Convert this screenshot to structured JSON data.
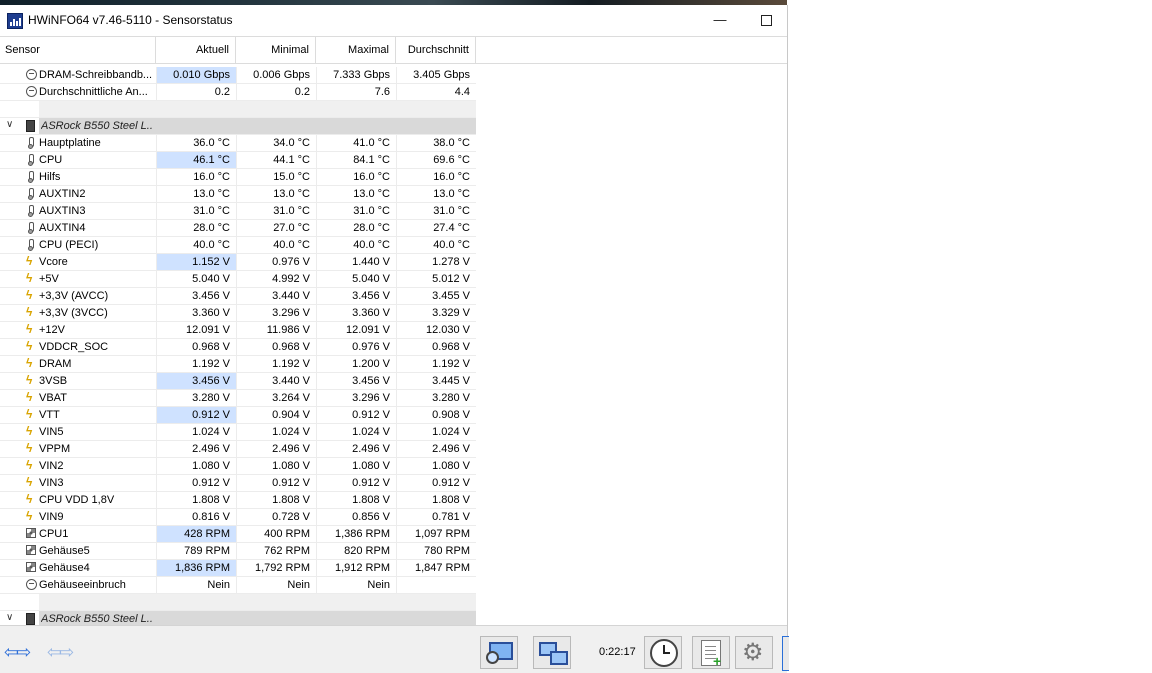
{
  "window": {
    "title": "HWiNFO64 v7.46-5110 - Sensorstatus",
    "min_glyph": "—"
  },
  "columns": {
    "sensor": "Sensor",
    "current": "Aktuell",
    "min": "Minimal",
    "max": "Maximal",
    "avg": "Durchschnitt"
  },
  "top_rows": [
    {
      "icon": "gauge-icon",
      "name": "DRAM-Schreibbandb...",
      "cur": "0.010 Gbps",
      "min": "0.006 Gbps",
      "max": "7.333 Gbps",
      "avg": "3.405 Gbps",
      "hl": true
    },
    {
      "icon": "gauge-icon",
      "name": "Durchschnittliche An...",
      "cur": "0.2",
      "min": "0.2",
      "max": "7.6",
      "avg": "4.4",
      "hl": false
    }
  ],
  "group1": {
    "name": "ASRock B550 Steel L...",
    "rows": [
      {
        "icon": "thermometer-icon",
        "name": "Hauptplatine",
        "cur": "36.0 °C",
        "min": "34.0 °C",
        "max": "41.0 °C",
        "avg": "38.0 °C",
        "hl": false
      },
      {
        "icon": "thermometer-icon",
        "name": "CPU",
        "cur": "46.1 °C",
        "min": "44.1 °C",
        "max": "84.1 °C",
        "avg": "69.6 °C",
        "hl": true
      },
      {
        "icon": "thermometer-icon",
        "name": "Hilfs",
        "cur": "16.0 °C",
        "min": "15.0 °C",
        "max": "16.0 °C",
        "avg": "16.0 °C",
        "hl": false
      },
      {
        "icon": "thermometer-icon",
        "name": "AUXTIN2",
        "cur": "13.0 °C",
        "min": "13.0 °C",
        "max": "13.0 °C",
        "avg": "13.0 °C",
        "hl": false
      },
      {
        "icon": "thermometer-icon",
        "name": "AUXTIN3",
        "cur": "31.0 °C",
        "min": "31.0 °C",
        "max": "31.0 °C",
        "avg": "31.0 °C",
        "hl": false
      },
      {
        "icon": "thermometer-icon",
        "name": "AUXTIN4",
        "cur": "28.0 °C",
        "min": "27.0 °C",
        "max": "28.0 °C",
        "avg": "27.4 °C",
        "hl": false
      },
      {
        "icon": "thermometer-icon",
        "name": "CPU (PECI)",
        "cur": "40.0 °C",
        "min": "40.0 °C",
        "max": "40.0 °C",
        "avg": "40.0 °C",
        "hl": false
      },
      {
        "icon": "voltage-icon",
        "name": "Vcore",
        "cur": "1.152 V",
        "min": "0.976 V",
        "max": "1.440 V",
        "avg": "1.278 V",
        "hl": true
      },
      {
        "icon": "voltage-icon",
        "name": "+5V",
        "cur": "5.040 V",
        "min": "4.992 V",
        "max": "5.040 V",
        "avg": "5.012 V",
        "hl": false
      },
      {
        "icon": "voltage-icon",
        "name": "+3,3V (AVCC)",
        "cur": "3.456 V",
        "min": "3.440 V",
        "max": "3.456 V",
        "avg": "3.455 V",
        "hl": false
      },
      {
        "icon": "voltage-icon",
        "name": "+3,3V (3VCC)",
        "cur": "3.360 V",
        "min": "3.296 V",
        "max": "3.360 V",
        "avg": "3.329 V",
        "hl": false
      },
      {
        "icon": "voltage-icon",
        "name": "+12V",
        "cur": "12.091 V",
        "min": "11.986 V",
        "max": "12.091 V",
        "avg": "12.030 V",
        "hl": false
      },
      {
        "icon": "voltage-icon",
        "name": "VDDCR_SOC",
        "cur": "0.968 V",
        "min": "0.968 V",
        "max": "0.976 V",
        "avg": "0.968 V",
        "hl": false
      },
      {
        "icon": "voltage-icon",
        "name": "DRAM",
        "cur": "1.192 V",
        "min": "1.192 V",
        "max": "1.200 V",
        "avg": "1.192 V",
        "hl": false
      },
      {
        "icon": "voltage-icon",
        "name": "3VSB",
        "cur": "3.456 V",
        "min": "3.440 V",
        "max": "3.456 V",
        "avg": "3.445 V",
        "hl": true
      },
      {
        "icon": "voltage-icon",
        "name": "VBAT",
        "cur": "3.280 V",
        "min": "3.264 V",
        "max": "3.296 V",
        "avg": "3.280 V",
        "hl": false
      },
      {
        "icon": "voltage-icon",
        "name": "VTT",
        "cur": "0.912 V",
        "min": "0.904 V",
        "max": "0.912 V",
        "avg": "0.908 V",
        "hl": true
      },
      {
        "icon": "voltage-icon",
        "name": "VIN5",
        "cur": "1.024 V",
        "min": "1.024 V",
        "max": "1.024 V",
        "avg": "1.024 V",
        "hl": false
      },
      {
        "icon": "voltage-icon",
        "name": "VPPM",
        "cur": "2.496 V",
        "min": "2.496 V",
        "max": "2.496 V",
        "avg": "2.496 V",
        "hl": false
      },
      {
        "icon": "voltage-icon",
        "name": "VIN2",
        "cur": "1.080 V",
        "min": "1.080 V",
        "max": "1.080 V",
        "avg": "1.080 V",
        "hl": false
      },
      {
        "icon": "voltage-icon",
        "name": "VIN3",
        "cur": "0.912 V",
        "min": "0.912 V",
        "max": "0.912 V",
        "avg": "0.912 V",
        "hl": false
      },
      {
        "icon": "voltage-icon",
        "name": "CPU VDD 1,8V",
        "cur": "1.808 V",
        "min": "1.808 V",
        "max": "1.808 V",
        "avg": "1.808 V",
        "hl": false
      },
      {
        "icon": "voltage-icon",
        "name": "VIN9",
        "cur": "0.816 V",
        "min": "0.728 V",
        "max": "0.856 V",
        "avg": "0.781 V",
        "hl": false
      },
      {
        "icon": "fan-icon",
        "name": "CPU1",
        "cur": "428 RPM",
        "min": "400 RPM",
        "max": "1,386 RPM",
        "avg": "1,097 RPM",
        "hl": true
      },
      {
        "icon": "fan-icon",
        "name": "Gehäuse5",
        "cur": "789 RPM",
        "min": "762 RPM",
        "max": "820 RPM",
        "avg": "780 RPM",
        "hl": false
      },
      {
        "icon": "fan-icon",
        "name": "Gehäuse4",
        "cur": "1,836 RPM",
        "min": "1,792 RPM",
        "max": "1,912 RPM",
        "avg": "1,847 RPM",
        "hl": true
      },
      {
        "icon": "gauge-icon",
        "name": "Gehäuseeinbruch",
        "cur": "Nein",
        "min": "Nein",
        "max": "Nein",
        "avg": "",
        "hl": false
      }
    ]
  },
  "group2": {
    "name": "ASRock B550 Steel L..."
  },
  "bottom": {
    "timer": "0:22:17"
  },
  "colors": {
    "highlight": "#cfe2ff",
    "group_header": "#d9d9d9",
    "voltage_icon": "#d9a400",
    "nav_arrow": "#2f6fd8"
  }
}
